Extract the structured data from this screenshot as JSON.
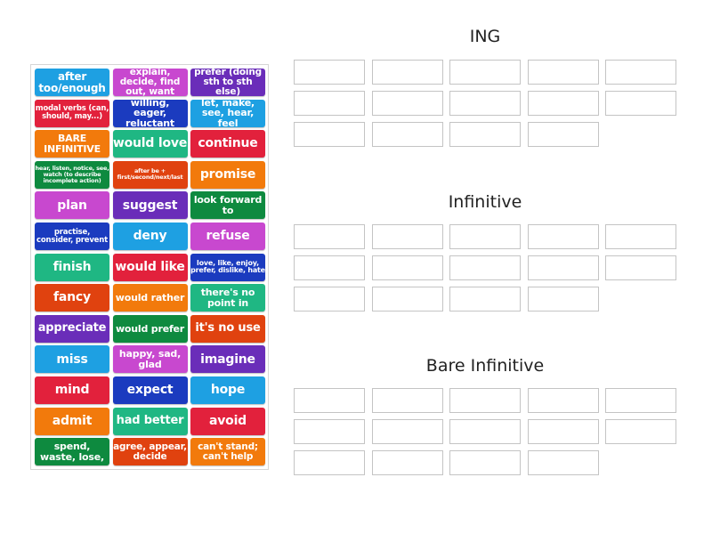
{
  "colors": {
    "lightblue": "#1ea0e2",
    "magenta": "#c848cf",
    "purple": "#6a2db9",
    "red": "#e2213c",
    "navy": "#1b3bbf",
    "orange": "#f27a0c",
    "teal": "#1fb783",
    "darkgreen": "#0e8a3f",
    "orangered": "#e0420f"
  },
  "tiles": [
    {
      "label": "after too/enough",
      "color": "lightblue",
      "size": 12
    },
    {
      "label": "explain, decide, find out, want",
      "color": "magenta",
      "size": 10.5
    },
    {
      "label": "prefer (doing sth to sth else)",
      "color": "purple",
      "size": 10.5
    },
    {
      "label": "modal verbs (can, should, may...)",
      "color": "red",
      "size": 8.5
    },
    {
      "label": "willing, eager, reluctant",
      "color": "navy",
      "size": 11
    },
    {
      "label": "let, make, see, hear, feel",
      "color": "lightblue",
      "size": 11
    },
    {
      "label": "BARE INFINITIVE",
      "color": "orange",
      "size": 11
    },
    {
      "label": "would love",
      "color": "teal",
      "size": 14
    },
    {
      "label": "continue",
      "color": "red",
      "size": 14
    },
    {
      "label": "hear, listen, notice, see, watch (to describe incomplete action)",
      "color": "darkgreen",
      "size": 6.5
    },
    {
      "label": "after be + first/second/next/last",
      "color": "orangered",
      "size": 6.5
    },
    {
      "label": "promise",
      "color": "orange",
      "size": 14
    },
    {
      "label": "plan",
      "color": "magenta",
      "size": 14
    },
    {
      "label": "suggest",
      "color": "purple",
      "size": 14
    },
    {
      "label": "look forward to",
      "color": "darkgreen",
      "size": 11
    },
    {
      "label": "practise, consider, prevent",
      "color": "navy",
      "size": 8.5
    },
    {
      "label": "deny",
      "color": "lightblue",
      "size": 14
    },
    {
      "label": "refuse",
      "color": "magenta",
      "size": 14
    },
    {
      "label": "finish",
      "color": "teal",
      "size": 14
    },
    {
      "label": "would like",
      "color": "red",
      "size": 14
    },
    {
      "label": "love, like, enjoy, prefer, dislike, hate",
      "color": "navy",
      "size": 8
    },
    {
      "label": "fancy",
      "color": "orangered",
      "size": 14
    },
    {
      "label": "would rather",
      "color": "orange",
      "size": 11
    },
    {
      "label": "there's no point in",
      "color": "teal",
      "size": 11
    },
    {
      "label": "appreciate",
      "color": "purple",
      "size": 13
    },
    {
      "label": "would prefer",
      "color": "darkgreen",
      "size": 11
    },
    {
      "label": "it's no use",
      "color": "orangered",
      "size": 13
    },
    {
      "label": "miss",
      "color": "lightblue",
      "size": 14
    },
    {
      "label": "happy, sad, glad",
      "color": "magenta",
      "size": 11
    },
    {
      "label": "imagine",
      "color": "purple",
      "size": 14
    },
    {
      "label": "mind",
      "color": "red",
      "size": 14
    },
    {
      "label": "expect",
      "color": "navy",
      "size": 14
    },
    {
      "label": "hope",
      "color": "lightblue",
      "size": 14
    },
    {
      "label": "admit",
      "color": "orange",
      "size": 14
    },
    {
      "label": "had better",
      "color": "teal",
      "size": 13
    },
    {
      "label": "avoid",
      "color": "red",
      "size": 14
    },
    {
      "label": "spend, waste, lose,",
      "color": "darkgreen",
      "size": 11
    },
    {
      "label": "agree, appear, decide",
      "color": "orangered",
      "size": 10.5
    },
    {
      "label": "can't stand; can't help",
      "color": "orange",
      "size": 10.5
    }
  ],
  "groups": [
    {
      "title": "ING",
      "slots": 14
    },
    {
      "title": "Infinitive",
      "slots": 14
    },
    {
      "title": "Bare Infinitive",
      "slots": 14
    }
  ]
}
